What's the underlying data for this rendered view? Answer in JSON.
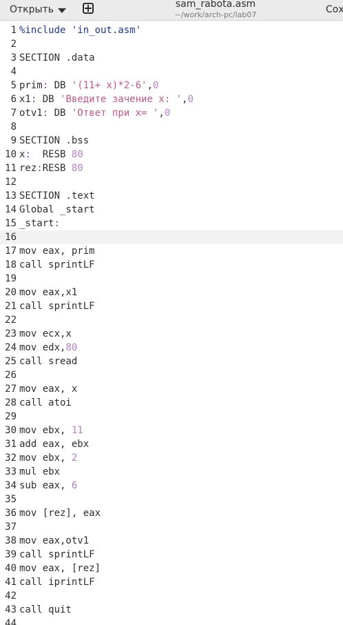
{
  "header": {
    "open_label": "Открыть",
    "title": "sam_rabota.asm",
    "subtitle": "~/work/arch-pc/lab07",
    "save_label": "Сох"
  },
  "editor": {
    "current_line": 16,
    "lines": [
      {
        "n": "1",
        "tokens": [
          {
            "t": "%include 'in_out.asm'",
            "c": "dir"
          }
        ]
      },
      {
        "n": "2",
        "tokens": []
      },
      {
        "n": "3",
        "tokens": [
          {
            "t": "SECTION .data",
            "c": ""
          }
        ]
      },
      {
        "n": "4",
        "tokens": []
      },
      {
        "n": "5",
        "tokens": [
          {
            "t": "prim",
            "c": ""
          },
          {
            "t": ":",
            "c": "lbl"
          },
          {
            "t": " DB ",
            "c": ""
          },
          {
            "t": "'(11+ x)*2-6'",
            "c": "str"
          },
          {
            "t": ",",
            "c": ""
          },
          {
            "t": "0",
            "c": "num"
          }
        ]
      },
      {
        "n": "6",
        "tokens": [
          {
            "t": "x1",
            "c": ""
          },
          {
            "t": ":",
            "c": "lbl"
          },
          {
            "t": " DB ",
            "c": ""
          },
          {
            "t": "'Введите зачение x: '",
            "c": "str"
          },
          {
            "t": ",",
            "c": ""
          },
          {
            "t": "0",
            "c": "num"
          }
        ]
      },
      {
        "n": "7",
        "tokens": [
          {
            "t": "otv1",
            "c": ""
          },
          {
            "t": ":",
            "c": "lbl"
          },
          {
            "t": " DB ",
            "c": ""
          },
          {
            "t": "'Ответ при x= '",
            "c": "str"
          },
          {
            "t": ",",
            "c": ""
          },
          {
            "t": "0",
            "c": "num"
          }
        ]
      },
      {
        "n": "8",
        "tokens": []
      },
      {
        "n": "9",
        "tokens": [
          {
            "t": "SECTION .bss",
            "c": ""
          }
        ]
      },
      {
        "n": "10",
        "tokens": [
          {
            "t": "x",
            "c": ""
          },
          {
            "t": ":",
            "c": "lbl"
          },
          {
            "t": "  RESB ",
            "c": ""
          },
          {
            "t": "80",
            "c": "num"
          }
        ]
      },
      {
        "n": "11",
        "tokens": [
          {
            "t": "rez",
            "c": ""
          },
          {
            "t": ":",
            "c": "lbl"
          },
          {
            "t": "RESB ",
            "c": ""
          },
          {
            "t": "80",
            "c": "num"
          }
        ]
      },
      {
        "n": "12",
        "tokens": []
      },
      {
        "n": "13",
        "tokens": [
          {
            "t": "SECTION .text",
            "c": ""
          }
        ]
      },
      {
        "n": "14",
        "tokens": [
          {
            "t": "Global _start",
            "c": ""
          }
        ]
      },
      {
        "n": "15",
        "tokens": [
          {
            "t": "_start",
            "c": ""
          },
          {
            "t": ":",
            "c": "lbl"
          }
        ]
      },
      {
        "n": "16",
        "tokens": []
      },
      {
        "n": "17",
        "tokens": [
          {
            "t": "mov eax, prim",
            "c": ""
          }
        ]
      },
      {
        "n": "18",
        "tokens": [
          {
            "t": "call sprintLF",
            "c": ""
          }
        ]
      },
      {
        "n": "19",
        "tokens": []
      },
      {
        "n": "20",
        "tokens": [
          {
            "t": "mov eax,x1",
            "c": ""
          }
        ]
      },
      {
        "n": "21",
        "tokens": [
          {
            "t": "call sprintLF",
            "c": ""
          }
        ]
      },
      {
        "n": "22",
        "tokens": []
      },
      {
        "n": "23",
        "tokens": [
          {
            "t": "mov ecx,x",
            "c": ""
          }
        ]
      },
      {
        "n": "24",
        "tokens": [
          {
            "t": "mov edx,",
            "c": ""
          },
          {
            "t": "80",
            "c": "num"
          }
        ]
      },
      {
        "n": "25",
        "tokens": [
          {
            "t": "call sread",
            "c": ""
          }
        ]
      },
      {
        "n": "26",
        "tokens": []
      },
      {
        "n": "27",
        "tokens": [
          {
            "t": "mov eax, x",
            "c": ""
          }
        ]
      },
      {
        "n": "28",
        "tokens": [
          {
            "t": "call atoi",
            "c": ""
          }
        ]
      },
      {
        "n": "29",
        "tokens": []
      },
      {
        "n": "30",
        "tokens": [
          {
            "t": "mov ebx, ",
            "c": ""
          },
          {
            "t": "11",
            "c": "num"
          }
        ]
      },
      {
        "n": "31",
        "tokens": [
          {
            "t": "add eax, ebx",
            "c": ""
          }
        ]
      },
      {
        "n": "32",
        "tokens": [
          {
            "t": "mov ebx, ",
            "c": ""
          },
          {
            "t": "2",
            "c": "num"
          }
        ]
      },
      {
        "n": "33",
        "tokens": [
          {
            "t": "mul ebx",
            "c": ""
          }
        ]
      },
      {
        "n": "34",
        "tokens": [
          {
            "t": "sub eax, ",
            "c": ""
          },
          {
            "t": "6",
            "c": "num"
          }
        ]
      },
      {
        "n": "35",
        "tokens": []
      },
      {
        "n": "36",
        "tokens": [
          {
            "t": "mov [rez], eax",
            "c": ""
          }
        ]
      },
      {
        "n": "37",
        "tokens": []
      },
      {
        "n": "38",
        "tokens": [
          {
            "t": "mov eax,otv1",
            "c": ""
          }
        ]
      },
      {
        "n": "39",
        "tokens": [
          {
            "t": "call sprintLF",
            "c": ""
          }
        ]
      },
      {
        "n": "40",
        "tokens": [
          {
            "t": "mov eax, [rez]",
            "c": ""
          }
        ]
      },
      {
        "n": "41",
        "tokens": [
          {
            "t": "call iprintLF",
            "c": ""
          }
        ]
      },
      {
        "n": "42",
        "tokens": []
      },
      {
        "n": "43",
        "tokens": [
          {
            "t": "call quit",
            "c": ""
          }
        ]
      },
      {
        "n": "44",
        "tokens": []
      }
    ]
  }
}
